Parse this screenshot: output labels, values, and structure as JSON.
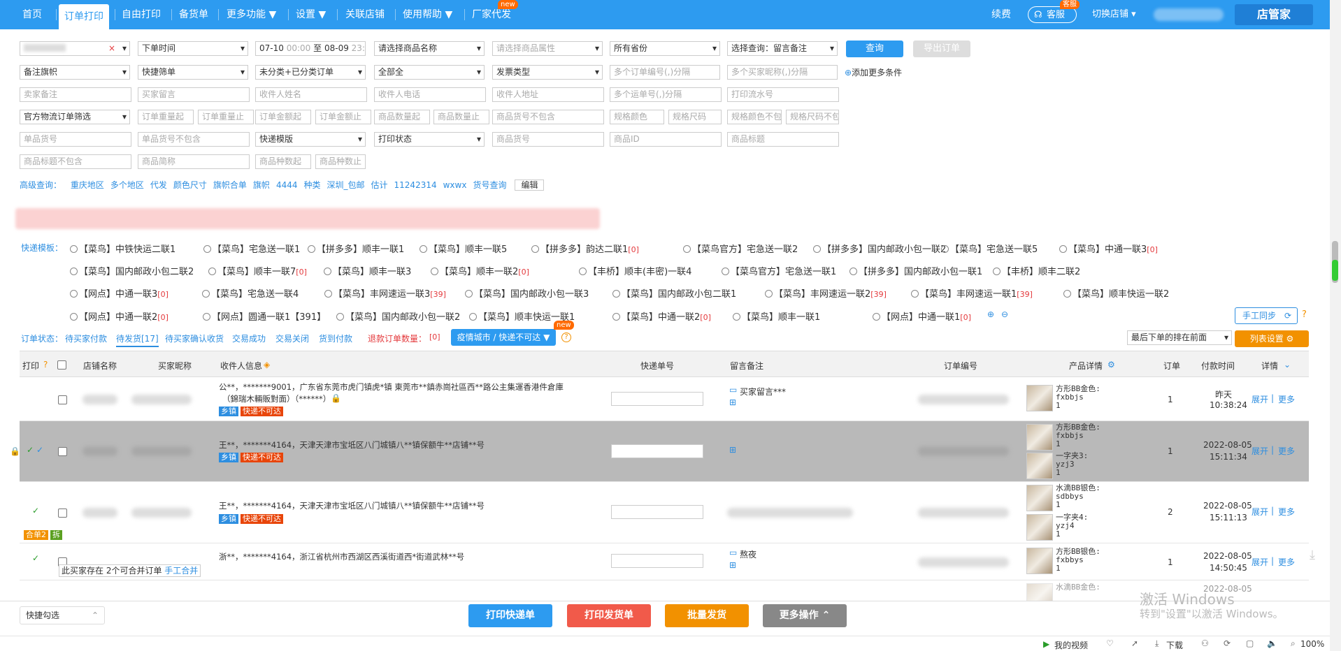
{
  "nav": {
    "items": [
      "首页",
      "订单打印",
      "自由打印",
      "备货单",
      "更多功能 ▼",
      "设置 ▼",
      "关联店铺",
      "使用帮助 ▼",
      "厂家代发"
    ],
    "new_badge": "new",
    "right": {
      "renew": "续费",
      "service": "客服",
      "service_badge": "客服",
      "switch_shop": "切换店铺 ▾",
      "brand": "店管家"
    }
  },
  "filters": {
    "order_time": "下单时间",
    "date_from": "07-10",
    "time_from": "00:00",
    "date_to_sep": "至",
    "date_to": "08-09",
    "time_to": "23:59",
    "product_name": "请选择商品名称",
    "product_attr": "请选择商品属性",
    "province": "所有省份",
    "query_select": "选择查询：留言备注",
    "query_btn": "查询",
    "export_btn": "导出订单",
    "flag": "备注旗帜",
    "quick_filter": "快捷筛单",
    "category": "未分类+已分类订单",
    "all": "全部全",
    "invoice": "发票类型",
    "order_nos": "多个订单编号(,)分隔",
    "buyer_nicks": "多个买家昵称(,)分隔",
    "add_more": "添加更多条件",
    "seller_note": "卖家备注",
    "buyer_msg": "买家留言",
    "recv_name": "收件人姓名",
    "recv_phone": "收件人电话",
    "recv_addr": "收件人地址",
    "waybill_nos": "多个运单号(,)分隔",
    "print_serial": "打印流水号",
    "official": "官方物流订单筛选",
    "weight_from": "订单重量起",
    "weight_to": "订单重量止",
    "amount_from": "订单金额起",
    "amount_to": "订单金额止",
    "qty_from": "商品数量起",
    "qty_to": "商品数量止",
    "sku_not": "商品货号不包含",
    "spec_color": "规格颜色",
    "spec_size": "规格尺码",
    "spec_color_not": "规格颜色不包",
    "spec_size_not": "规格尺码不包",
    "unit_sku": "单品货号",
    "unit_sku_not": "单品货号不包含",
    "template": "快递模版",
    "print_status": "打印状态",
    "product_sku": "商品货号",
    "product_id": "商品ID",
    "product_title": "商品标题",
    "title_not": "商品标题不包含",
    "short_name": "商品简称",
    "kinds_from": "商品种数起",
    "kinds_to": "商品种数止"
  },
  "advanced": {
    "label": "高级查询：",
    "links": [
      "重庆地区",
      "多个地区",
      "代发",
      "颜色尺寸",
      "旗帜合单",
      "旗帜",
      "4444",
      "种类",
      "深圳_包邮",
      "估计",
      "11242314",
      "wxwx",
      "货号查询"
    ],
    "edit": "编辑"
  },
  "templates": {
    "label": "快递模板：",
    "rows": [
      [
        [
          "【菜鸟】中铁快运二联1",
          ""
        ],
        [
          "【菜鸟】宅急送一联1",
          ""
        ],
        [
          "【拼多多】顺丰一联1",
          ""
        ],
        [
          "【菜鸟】顺丰一联5",
          ""
        ],
        [
          "【拼多多】韵达二联1",
          "[0]"
        ],
        [
          "【菜鸟官方】宅急送一联2",
          ""
        ],
        [
          "【拼多多】国内邮政小包一联2",
          ""
        ],
        [
          "【菜鸟】宅急送一联5",
          ""
        ],
        [
          "【菜鸟】中通一联3",
          "[0]"
        ]
      ],
      [
        [
          "【菜鸟】国内邮政小包二联2",
          ""
        ],
        [
          "【菜鸟】顺丰一联7",
          "[0]"
        ],
        [
          "【菜鸟】顺丰一联3",
          ""
        ],
        [
          "【菜鸟】顺丰一联2",
          "[0]"
        ],
        [
          "【丰桥】顺丰(丰密)一联4",
          ""
        ],
        [
          "【菜鸟官方】宅急送一联1",
          ""
        ],
        [
          "【拼多多】国内邮政小包一联1",
          ""
        ],
        [
          "【丰桥】顺丰二联2",
          ""
        ]
      ],
      [
        [
          "【网点】中通一联3",
          "[0]"
        ],
        [
          "【菜鸟】宅急送一联4",
          ""
        ],
        [
          "【菜鸟】丰网速运一联3",
          "[39]"
        ],
        [
          "【菜鸟】国内邮政小包一联3",
          ""
        ],
        [
          "【菜鸟】国内邮政小包二联1",
          ""
        ],
        [
          "【菜鸟】丰网速运一联2",
          "[39]"
        ],
        [
          "【菜鸟】丰网速运一联1",
          "[39]"
        ],
        [
          "【菜鸟】顺丰快运一联2",
          ""
        ]
      ],
      [
        [
          "【网点】中通一联2",
          "[0]"
        ],
        [
          "【网点】圆通一联1【391】",
          ""
        ],
        [
          "【菜鸟】国内邮政小包一联2",
          ""
        ],
        [
          "【菜鸟】顺丰快运一联1",
          ""
        ],
        [
          "【菜鸟】中通一联2",
          "[0]"
        ],
        [
          "【菜鸟】顺丰一联1",
          ""
        ],
        [
          "【网点】中通一联1",
          "[0]"
        ]
      ]
    ],
    "sync": "手工同步"
  },
  "status": {
    "label": "订单状态：",
    "tabs": [
      "待买家付款",
      "待发货[17]",
      "待买家确认收货",
      "交易成功",
      "交易关闭",
      "货到付款"
    ],
    "refund": "退款订单数量：",
    "refund_count": "[0]",
    "epidemic": "疫情城市 / 快递不可达",
    "epidemic_badge": "new",
    "sort": "最后下单的排在前面",
    "list_settings": "列表设置"
  },
  "table": {
    "headers": [
      "打印",
      "店铺名称",
      "买家昵称",
      "收件人信息",
      "快递单号",
      "留言备注",
      "订单编号",
      "产品详情",
      "订单",
      "付款时间",
      "详情"
    ],
    "rows": [
      {
        "addr1": "公**，*******9001，广东省东莞市虎门镇虎*镇 東莞市**鎮赤崗社區西**路公主集運香港件倉庫",
        "addr2": "（錦瑞木輛販對面）（******）",
        "tags": [
          "乡镇",
          "快递不可达"
        ],
        "note": "买家留言***",
        "prod": [
          [
            "方形BB金色:",
            "fxbbjs",
            "1"
          ]
        ],
        "qty": "1",
        "pay1": "昨天",
        "pay2": "10:38:24",
        "expand": "展开",
        "more": "更多"
      },
      {
        "addr1": "王**，*******4164，天津天津市宝坻区八门城镇八**镇保额牛**店铺**号",
        "tags": [
          "乡镇",
          "快递不可达"
        ],
        "prod": [
          [
            "方形BB金色:",
            "fxbbjs",
            "1"
          ],
          [
            "一字夹3:",
            "yzj3",
            "1"
          ]
        ],
        "qty": "1",
        "pay1": "2022-08-05",
        "pay2": "15:11:34",
        "expand": "展开",
        "more": "更多"
      },
      {
        "addr1": "王**，*******4164，天津天津市宝坻区八门城镇八**镇保额牛**店铺**号",
        "tags": [
          "乡镇",
          "快递不可达"
        ],
        "order_tags": [
          "合单2",
          "拆"
        ],
        "prod": [
          [
            "水滴BB银色:",
            "sdbbys",
            "1"
          ],
          [
            "一字夹4:",
            "yzj4",
            "1"
          ]
        ],
        "qty": "2",
        "pay1": "2022-08-05",
        "pay2": "15:11:13",
        "expand": "展开",
        "more": "更多"
      },
      {
        "addr1": "浙**，*******4164，浙江省杭州市西湖区西溪街道西*街道武林**号",
        "note": "熬夜",
        "merge_tip": "此买家存在 2个可合并订单",
        "merge_link": "手工合并",
        "prod": [
          [
            "方形BB银色:",
            "fxbbys",
            "1"
          ]
        ],
        "qty": "1",
        "pay1": "2022-08-05",
        "pay2": "14:50:45",
        "expand": "展开",
        "more": "更多"
      },
      {
        "prod": [
          [
            "水滴BB金色:",
            "",
            ""
          ]
        ],
        "pay1": "2022-08-05"
      }
    ]
  },
  "bottom": {
    "quick_select": "快捷勾选",
    "print_express": "打印快递单",
    "print_invoice": "打印发货单",
    "batch_ship": "批量发货",
    "more_ops": "更多操作"
  },
  "watermark": {
    "line1": "激活 Windows",
    "line2": "转到\"设置\"以激活 Windows。"
  },
  "statusbar": {
    "video": "我的视频",
    "download": "下载",
    "zoom": "100%"
  },
  "colors": {
    "primary": "#2d9bf0",
    "danger": "#e8450a",
    "orange": "#f29100",
    "link": "#2d8ee0"
  }
}
